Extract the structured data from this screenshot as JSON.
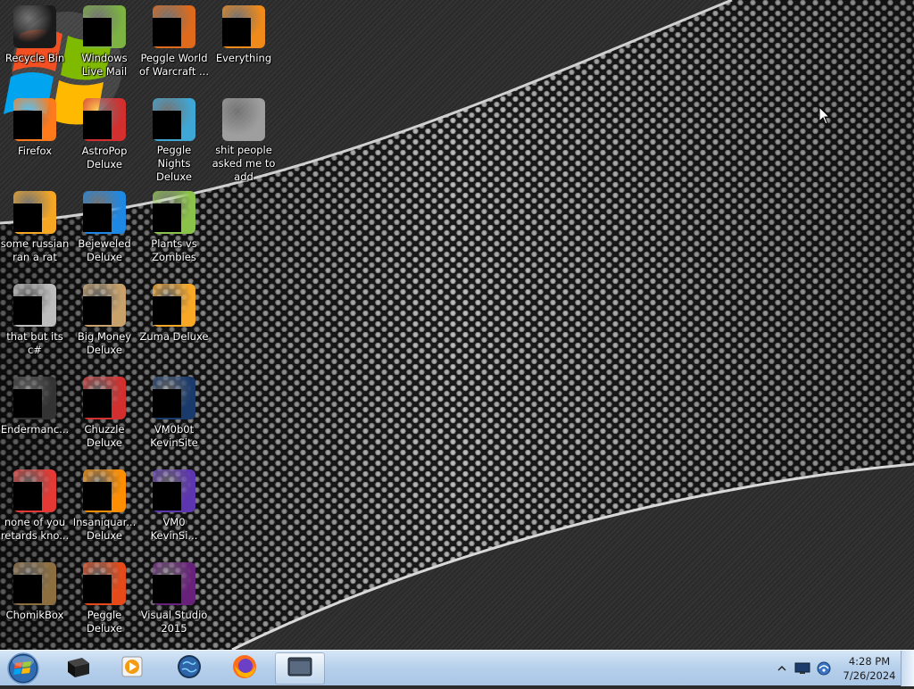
{
  "desktop": {
    "icons": [
      {
        "label": "Recycle Bin",
        "icon": "recycle-bin-icon",
        "color": "#1a1a1a",
        "redacted": false
      },
      {
        "label": "Windows Live Mail",
        "icon": "windows-live-mail-icon",
        "color": "#7cb342",
        "redacted": true
      },
      {
        "label": "Peggle World of Warcraft ...",
        "icon": "peggle-wow-icon",
        "color": "#e06a1b",
        "redacted": true
      },
      {
        "label": "Everything",
        "icon": "everything-icon",
        "color": "#f08a1a",
        "redacted": true
      },
      {
        "label": "Firefox",
        "icon": "firefox-icon",
        "color": "#ff7a1a",
        "redacted": true
      },
      {
        "label": "AstroPop Deluxe",
        "icon": "astropop-icon",
        "color": "#d32f2f",
        "redacted": true
      },
      {
        "label": "Peggle Nights Deluxe",
        "icon": "peggle-nights-icon",
        "color": "#3fa7d6",
        "redacted": true
      },
      {
        "label": "shit people asked me to add",
        "icon": "folder-icon",
        "color": "#9e9e9e",
        "redacted": false
      },
      {
        "label": "some russian ran a rat",
        "icon": "app-orange-icon",
        "color": "#f5a623",
        "redacted": true
      },
      {
        "label": "Bejeweled Deluxe",
        "icon": "bejeweled-icon",
        "color": "#1e88e5",
        "redacted": true
      },
      {
        "label": "Plants vs Zombies",
        "icon": "plants-vs-zombies-icon",
        "color": "#8bc34a",
        "redacted": true
      },
      {
        "label": "that but its c#",
        "icon": "shortcut-window-icon",
        "color": "#bdbdbd",
        "redacted": true
      },
      {
        "label": "Big Money Deluxe",
        "icon": "big-money-icon",
        "color": "#c9a26b",
        "redacted": true
      },
      {
        "label": "Zuma Deluxe",
        "icon": "zuma-icon",
        "color": "#f9a825",
        "redacted": true
      },
      {
        "label": "Endermanc...",
        "icon": "console-window-icon",
        "color": "#333333",
        "redacted": true
      },
      {
        "label": "Chuzzle Deluxe",
        "icon": "chuzzle-icon",
        "color": "#d32f2f",
        "redacted": true
      },
      {
        "label": "VM0b0t KevinSite",
        "icon": "vm-kevin-icon",
        "color": "#1a3a6b",
        "redacted": true
      },
      {
        "label": "none of you retards kno...",
        "icon": "red-swirl-icon",
        "color": "#e53935",
        "redacted": true
      },
      {
        "label": "Insaniquar... Deluxe",
        "icon": "insaniquarium-icon",
        "color": "#ff8f00",
        "redacted": true
      },
      {
        "label": "VM0 KevinSi...",
        "icon": "vm0-kevin-icon",
        "color": "#5e35b1",
        "redacted": true
      },
      {
        "label": "ChomikBox",
        "icon": "chomikbox-icon",
        "color": "#8d6e3f",
        "redacted": true
      },
      {
        "label": "Peggle Deluxe",
        "icon": "peggle-deluxe-icon",
        "color": "#e64a19",
        "redacted": true
      },
      {
        "label": "Visual Studio 2015",
        "icon": "visual-studio-icon",
        "color": "#68217a",
        "redacted": true
      }
    ]
  },
  "taskbar": {
    "start_icon": "windows-start-orb-icon",
    "pinned": [
      {
        "name": "taskbar-app-dark-box",
        "icon": "dark-box-icon",
        "active": false
      },
      {
        "name": "taskbar-app-media-player",
        "icon": "media-player-icon",
        "active": false
      },
      {
        "name": "taskbar-app-globe",
        "icon": "globe-icon",
        "active": false
      },
      {
        "name": "taskbar-app-firefox",
        "icon": "firefox-icon",
        "active": false
      },
      {
        "name": "taskbar-app-window",
        "icon": "window-app-icon",
        "active": true
      }
    ],
    "tray": {
      "icons": [
        "show-hidden-icons-chevron-icon",
        "monitor-icon",
        "network-icon"
      ],
      "time": "4:28 PM",
      "date": "7/26/2024"
    }
  },
  "colors": {
    "taskbar_top": "#d6e6f6",
    "taskbar_bottom": "#a9c6e6",
    "win_red": "#f25022",
    "win_green": "#7fba00",
    "win_blue": "#00a4ef",
    "win_yellow": "#ffb900"
  }
}
